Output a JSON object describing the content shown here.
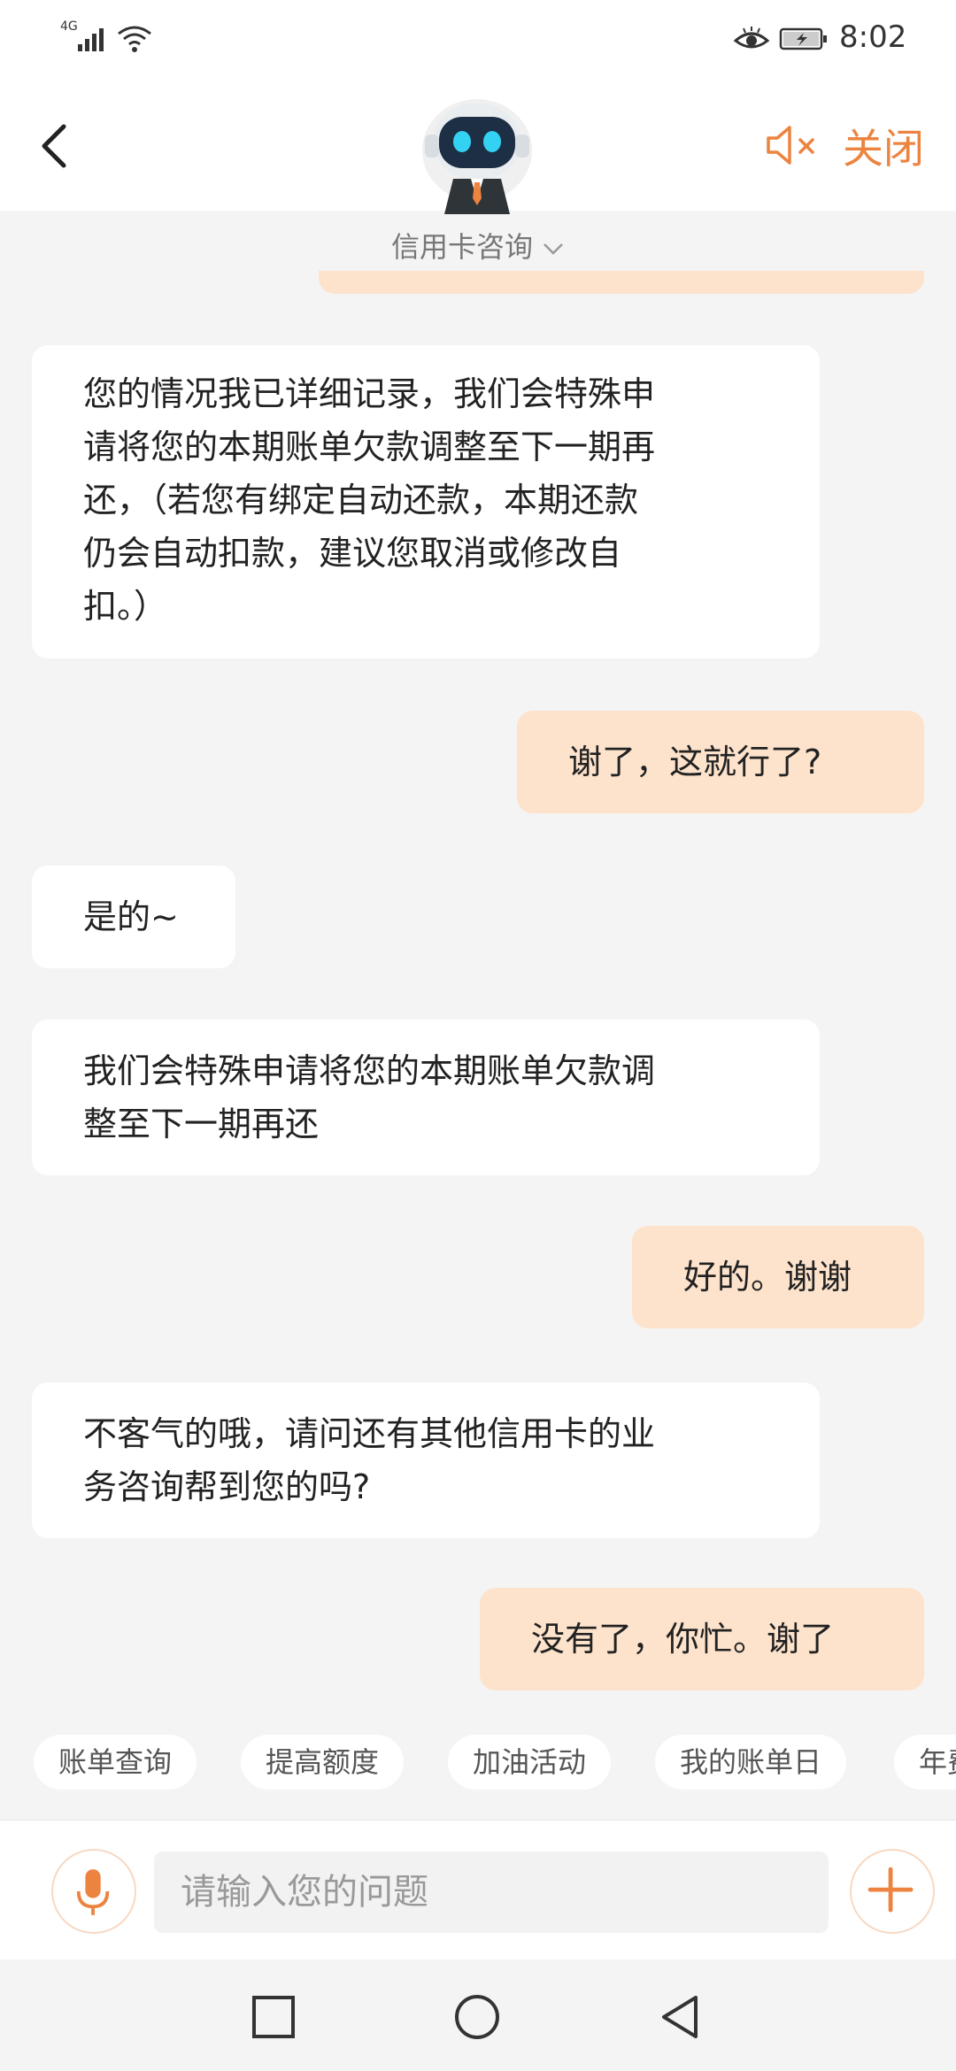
{
  "status_bar": {
    "network": "4G",
    "time": "8:02"
  },
  "header": {
    "close_label": "关闭",
    "service": "信用卡咨询"
  },
  "messages": [
    {
      "role": "bot",
      "lines": [
        "您的情况我已详细记录，我们会特殊申",
        "请将您的本期账单欠款调整至下一期再",
        "还，（若您有绑定自动还款，本期还款",
        "仍会自动扣款，建议您取消或修改自",
        "扣。）"
      ]
    },
    {
      "role": "user",
      "lines": [
        "谢了，这就行了?"
      ]
    },
    {
      "role": "bot",
      "lines": [
        "是的~"
      ]
    },
    {
      "role": "bot",
      "lines": [
        "我们会特殊申请将您的本期账单欠款调",
        "整至下一期再还"
      ]
    },
    {
      "role": "user",
      "lines": [
        "好的。谢谢"
      ]
    },
    {
      "role": "bot",
      "lines": [
        "不客气的哦，请问还有其他信用卡的业",
        "务咨询帮到您的吗?"
      ]
    },
    {
      "role": "user",
      "lines": [
        "没有了，你忙。谢了"
      ]
    }
  ],
  "quick_replies": [
    "账单查询",
    "提高额度",
    "加油活动",
    "我的账单日",
    "年费"
  ],
  "input": {
    "placeholder": "请输入您的问题"
  },
  "colors": {
    "accent": "#ec8440",
    "user_bubble": "#fde3cc",
    "bot_bubble": "#ffffff",
    "background": "#f4f4f4"
  },
  "icons": {
    "back": "chevron-left-icon",
    "avatar": "robot-avatar-icon",
    "sound": "speaker-muted-icon",
    "mic": "microphone-icon",
    "plus": "plus-icon",
    "nav": [
      "square-icon",
      "circle-icon",
      "triangle-back-icon"
    ]
  }
}
